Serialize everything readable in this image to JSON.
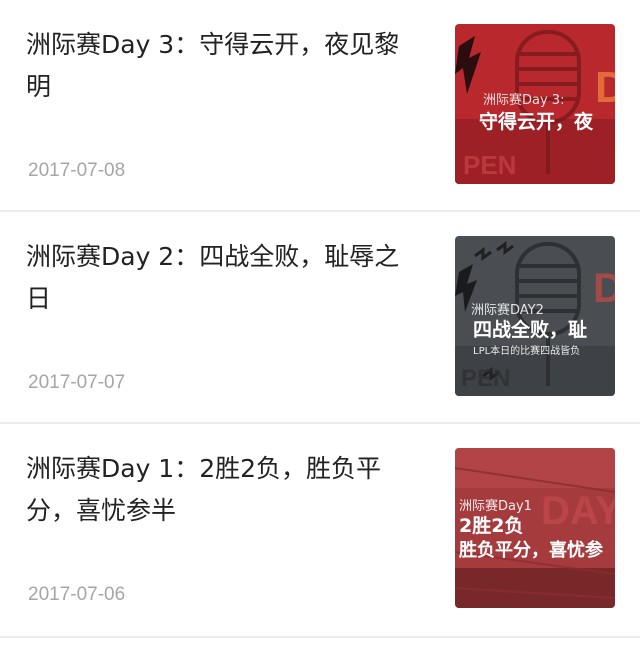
{
  "articles": [
    {
      "title": "洲际赛Day 3：守得云开，夜见黎明",
      "date": "2017-07-08",
      "thumb": {
        "small": "洲际赛Day 3:",
        "big": "守得云开，夜",
        "corner": "D",
        "bg": "#b8282d",
        "dark": "#7a1a1d"
      }
    },
    {
      "title": "洲际赛Day 2：四战全败，耻辱之日",
      "date": "2017-07-07",
      "thumb": {
        "small": "洲际赛DAY2",
        "big": "四战全败，耻",
        "sub": "LPL本日的比赛四战皆负",
        "corner": "D",
        "bg": "#4a4d52",
        "dark": "#2c2e31"
      }
    },
    {
      "title": "洲际赛Day 1：2胜2负，胜负平分，喜忧参半",
      "date": "2017-07-06",
      "thumb": {
        "small": "洲际赛Day1",
        "big": "2胜2负",
        "big2": "胜负平分，喜忧参",
        "corner": "DAY",
        "bg": "#a63b3e",
        "dark": "#6e2426"
      }
    }
  ]
}
